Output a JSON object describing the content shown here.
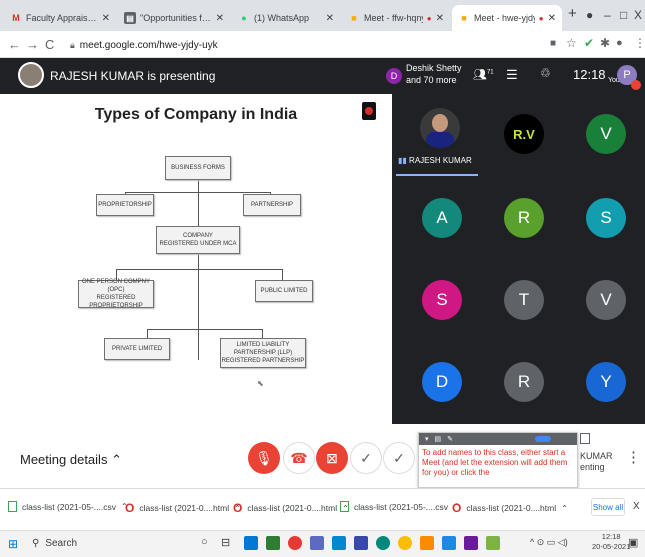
{
  "browser": {
    "tabs": [
      {
        "title": "Faculty Appraisal - Invitation",
        "icon_glyph": "M",
        "icon_color": "#d93025",
        "active": false
      },
      {
        "title": "\"Opportunities for Students",
        "icon_glyph": "▤",
        "icon_color": "#5f6368",
        "active": false
      },
      {
        "title": "(1) WhatsApp",
        "icon_glyph": "●",
        "icon_color": "#25d366",
        "active": false
      },
      {
        "title": "Meet - ffw-hqny-osh",
        "icon_glyph": "■",
        "icon_color": "#f9ab00",
        "active": false
      },
      {
        "title": "Meet - hwe-yjdy-uyk",
        "icon_glyph": "■",
        "icon_color": "#f9ab00",
        "active": true
      }
    ],
    "new_tab": "+",
    "window_controls": {
      "minimize": "–",
      "maximize": "□",
      "close": "X"
    },
    "url": "meet.google.com/hwe-yjdy-uyk",
    "profile_initial": "P"
  },
  "meet": {
    "presenting_text": "RAJESH KUMAR is presenting",
    "participants_badge_initial": "D",
    "participants_text_line1": "Deshik Shetty",
    "participants_text_line2": "and 70 more",
    "participants_count": "71",
    "time": "12:18",
    "you_label": "You",
    "you_initial": "P",
    "meeting_details": "Meeting details"
  },
  "slide": {
    "title": "Types of Company in India",
    "nodes": {
      "business_forms": "BUSINESS FORMS",
      "proprietorship": "PROPRIETORSHIP",
      "partnership": "PARTNERSHIP",
      "company_l1": "COMPANY",
      "company_l2": "REGISTERED UNDER MCA",
      "opc_l1": "ONE PERSON COMPNY (OPC)",
      "opc_l2": "REGISTERED PROPRIETORSHIP",
      "public": "PUBLIC LIMITED",
      "private": "PRIVATE LIMITED",
      "llp_l1": "LIMITED LIABILITY PARTNERSHIP (LLP)",
      "llp_l2": "REGISTERED PARTNERSHIP"
    }
  },
  "participants": [
    {
      "name": "RAJESH KUMAR",
      "initial": "",
      "color": "#3c4043",
      "speaking": true
    },
    {
      "name": "",
      "initial": "R.V",
      "color": "#1e8e3e"
    },
    {
      "name": "",
      "initial": "V",
      "color": "#188038"
    },
    {
      "name": "",
      "initial": "A",
      "color": "#12897b"
    },
    {
      "name": "",
      "initial": "R",
      "color": "#5aa02c"
    },
    {
      "name": "",
      "initial": "S",
      "color": "#129eaf"
    },
    {
      "name": "",
      "initial": "S",
      "color": "#d01884"
    },
    {
      "name": "",
      "initial": "T",
      "color": "#5f6368"
    },
    {
      "name": "",
      "initial": "V",
      "color": "#5f6368"
    },
    {
      "name": "",
      "initial": "D",
      "color": "#1a73e8"
    },
    {
      "name": "",
      "initial": "R",
      "color": "#5f6368"
    },
    {
      "name": "",
      "initial": "Y",
      "color": "#1967d2"
    }
  ],
  "extension_popup": {
    "text": "To add names to this class, either start a Meet (and let the extension will add them for you) or click the",
    "side_text_l1": "KUMAR",
    "side_text_l2": "enting"
  },
  "downloads": {
    "items": [
      {
        "name": "class-list (2021-05-....csv",
        "icon_color": "#34a853"
      },
      {
        "name": "class-list (2021-0....html",
        "icon_color": "#d93025"
      },
      {
        "name": "class-list (2021-0....html",
        "icon_color": "#d93025"
      },
      {
        "name": "class-list (2021-05-....csv",
        "icon_color": "#34a853"
      },
      {
        "name": "class-list (2021-0....html",
        "icon_color": "#d93025"
      }
    ],
    "show_all": "Show all",
    "close": "X"
  },
  "taskbar": {
    "search_placeholder": "Search",
    "time": "12:18",
    "date": "20-05-2021",
    "app_colors": [
      "#3c4043",
      "#5f6368",
      "#0078d4",
      "#2e7d32",
      "#e53935",
      "#5c6bc0",
      "#0288d1",
      "#00897b",
      "#f4b400",
      "#fb8c00",
      "#1e88e5",
      "#6a1b9a",
      "#7cb342"
    ]
  }
}
